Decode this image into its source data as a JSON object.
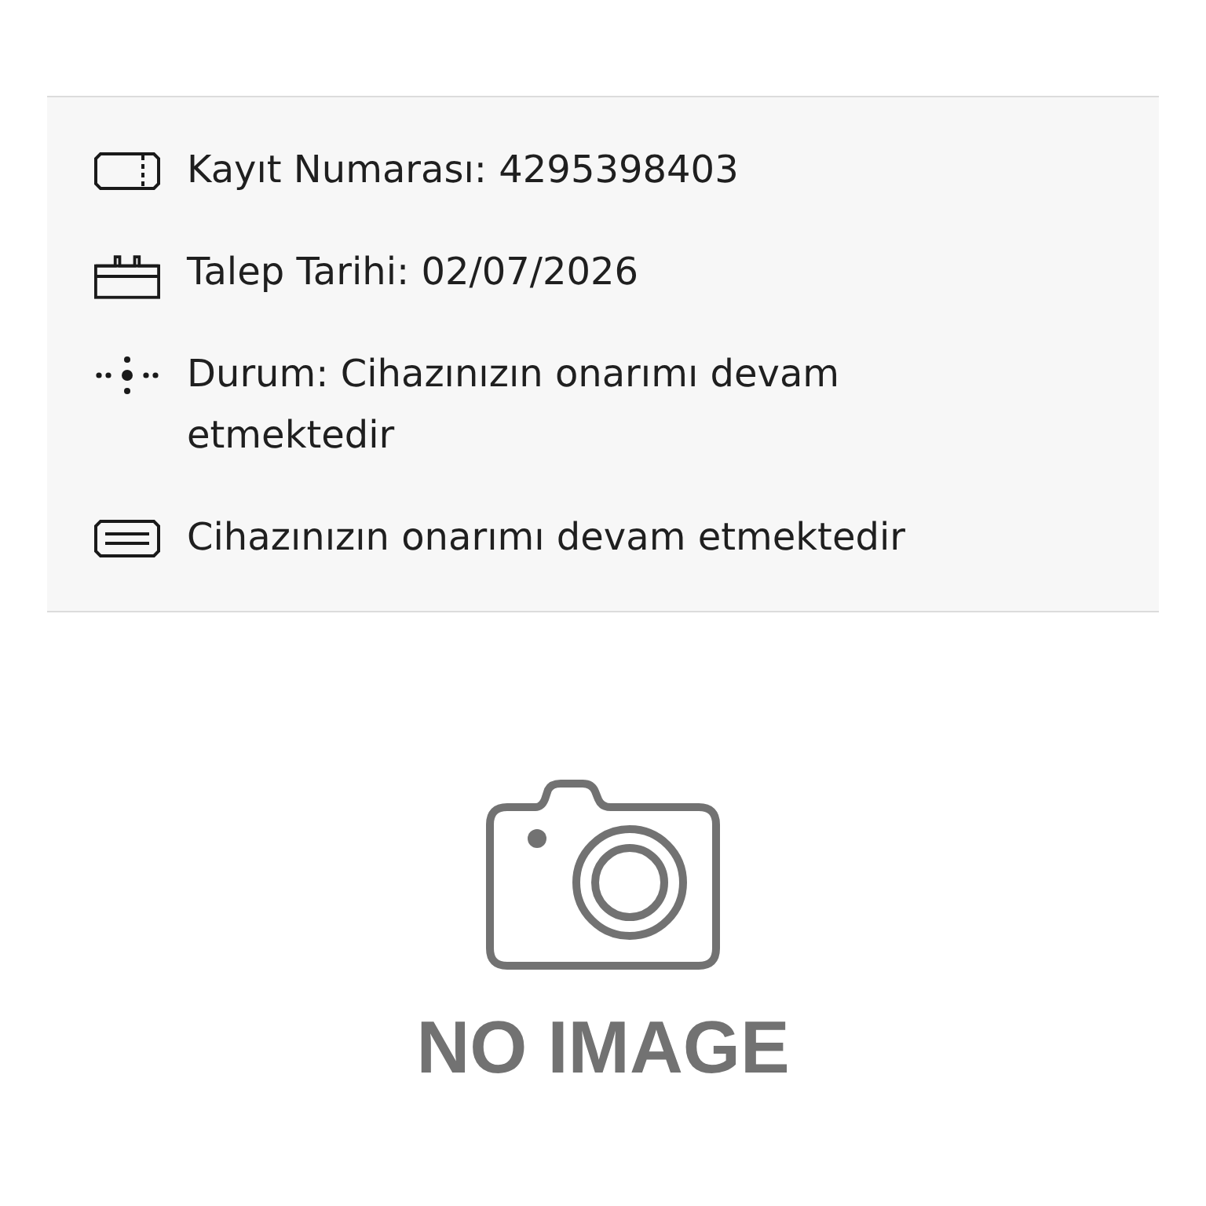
{
  "record_details": {
    "items": [
      {
        "kind": "ticket",
        "text": "Kayıt Numarası: 4295398403"
      },
      {
        "kind": "calendar",
        "text": "Talep Tarihi: 02/07/2026"
      },
      {
        "kind": "status",
        "text": "Durum: Cihazınızın onarımı devam etmektedir"
      },
      {
        "kind": "note",
        "text": "Cihazınızın onarımı devam etmektedir"
      }
    ]
  },
  "image_placeholder": {
    "text": "NO IMAGE"
  }
}
